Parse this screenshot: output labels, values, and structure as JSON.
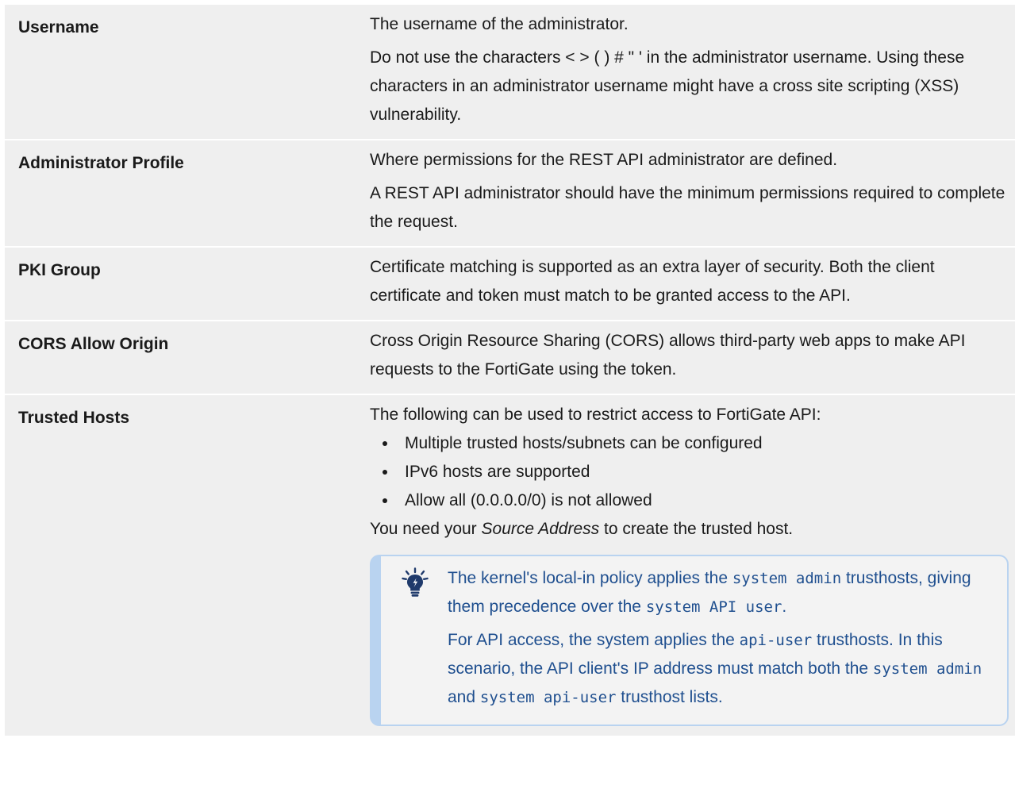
{
  "rows": [
    {
      "label": "Username",
      "desc": [
        "The username of the administrator.",
        "Do not use the characters < > ( ) # \" ' in the administrator username. Using these characters in an administrator username might have a cross site scripting (XSS) vulnerability."
      ]
    },
    {
      "label": "Administrator Profile",
      "desc": [
        "Where permissions for the REST API administrator are defined.",
        "A REST API administrator should have the minimum permissions required to complete the request."
      ]
    },
    {
      "label": "PKI Group",
      "desc": [
        "Certificate matching is supported as an extra layer of security. Both the client certificate and token must match to be granted access to the API."
      ]
    },
    {
      "label": "CORS Allow Origin",
      "desc": [
        "Cross Origin Resource Sharing (CORS) allows third-party web apps to make API requests to the FortiGate using the token."
      ]
    },
    {
      "label": "Trusted Hosts",
      "intro": "The following can be used to restrict access to FortiGate API:",
      "bullets": [
        "Multiple trusted hosts/subnets can be configured",
        "IPv6 hosts are supported",
        "Allow all (0.0.0.0/0) is not allowed"
      ],
      "outro_before": "You need your ",
      "outro_em": "Source Address",
      "outro_after": " to create the trusted host."
    }
  ],
  "note": {
    "icon": "lightbulb-icon",
    "p1_a": "The kernel's local-in policy applies the ",
    "p1_code1": "system admin",
    "p1_b": " trusthosts, giving them precedence over the ",
    "p1_code2": "system API user",
    "p1_c": ".",
    "p2_a": "For API access, the system applies the ",
    "p2_code1": "api-user",
    "p2_b": " trusthosts. In this scenario, the API client's IP address must match both the ",
    "p2_code2": "system admin",
    "p2_c": " and ",
    "p2_code3": "system api-user",
    "p2_d": " trusthost lists."
  },
  "colors": {
    "row_bg": "#efefef",
    "note_border": "#b9d3f0",
    "note_text": "#1f4f8f"
  }
}
